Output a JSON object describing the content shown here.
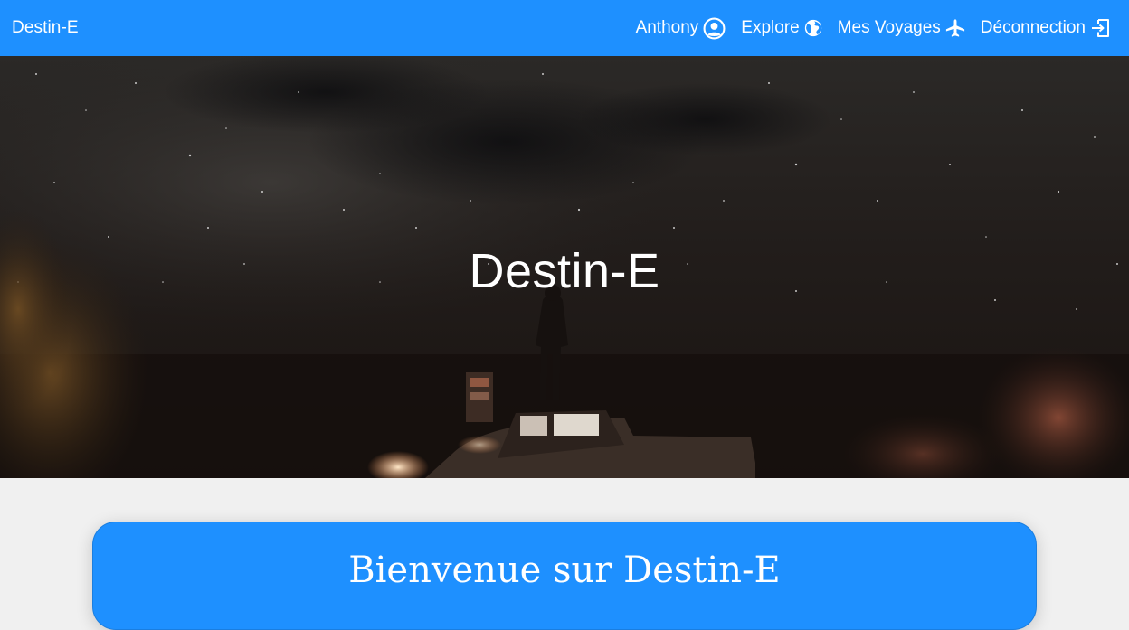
{
  "navbar": {
    "brand": "Destin-E",
    "links": [
      {
        "label": "Anthony",
        "icon": "user-circle-icon"
      },
      {
        "label": "Explore",
        "icon": "globe-icon"
      },
      {
        "label": "Mes Voyages",
        "icon": "plane-icon"
      },
      {
        "label": "Déconnection",
        "icon": "sign-out-icon"
      }
    ]
  },
  "hero": {
    "title": "Destin-E"
  },
  "welcome": {
    "title": "Bienvenue sur Destin-E"
  },
  "colors": {
    "primary": "#1e90ff",
    "background": "#f0f0f0",
    "text_on_primary": "#ffffff"
  }
}
